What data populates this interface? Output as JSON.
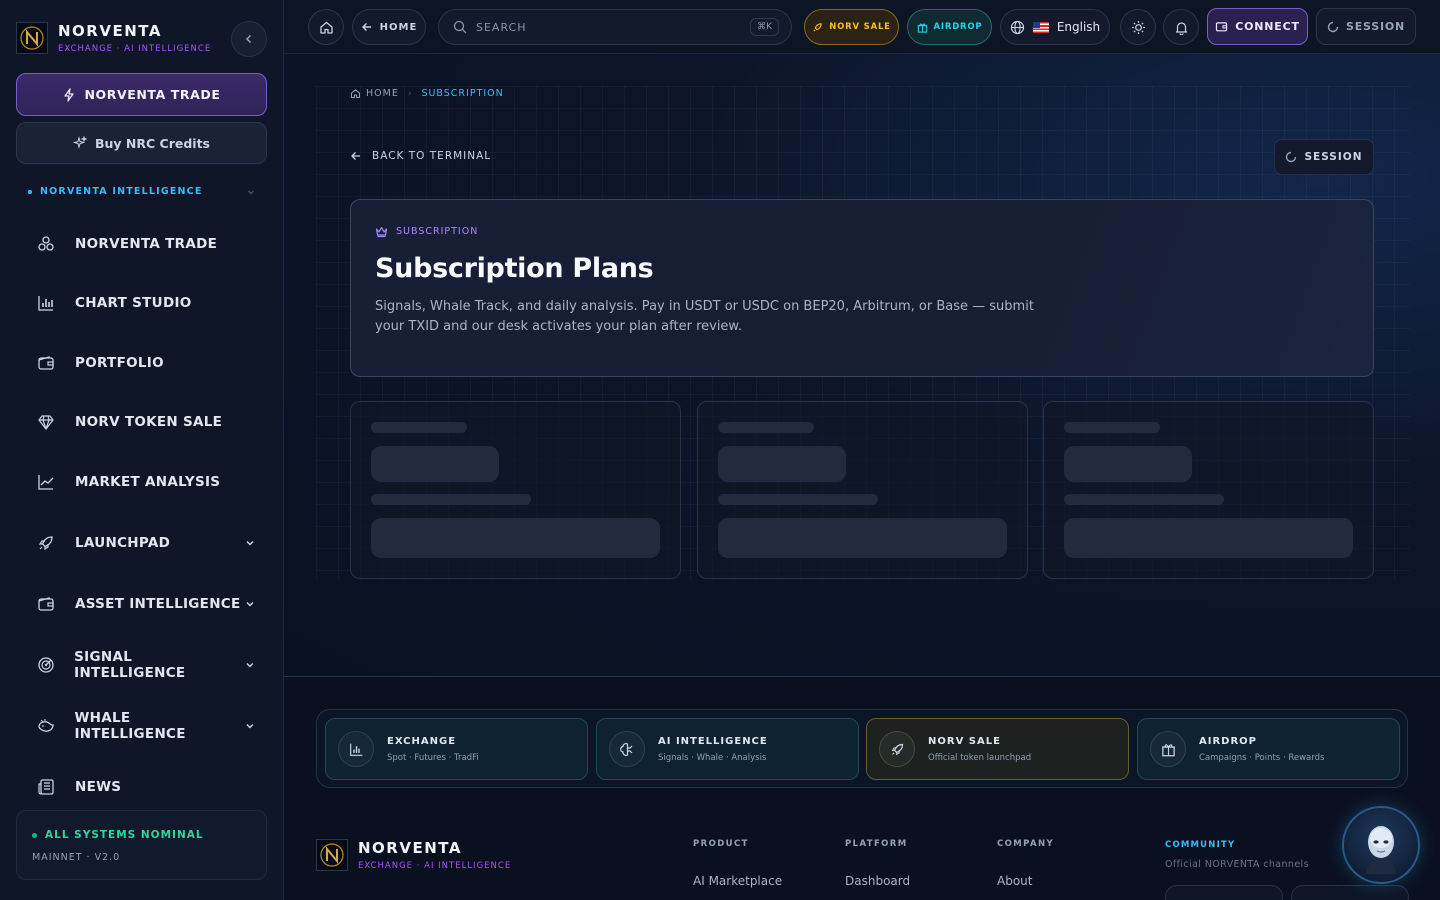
{
  "brand": {
    "name": "NORVENTA",
    "tagline": "EXCHANGE · AI INTELLIGENCE"
  },
  "sidebar": {
    "primary_button": "NORVENTA TRADE",
    "secondary_button": "Buy NRC Credits",
    "section_title": "NORVENTA INTELLIGENCE",
    "items": [
      {
        "label": "NORVENTA TRADE",
        "icon": "nodes-icon"
      },
      {
        "label": "CHART STUDIO",
        "icon": "chart-bars-icon"
      },
      {
        "label": "PORTFOLIO",
        "icon": "wallet-icon"
      },
      {
        "label": "NORV TOKEN SALE",
        "icon": "diamond-icon"
      },
      {
        "label": "MARKET ANALYSIS",
        "icon": "line-chart-icon"
      },
      {
        "label": "LAUNCHPAD",
        "icon": "rocket-icon"
      },
      {
        "label": "ASSET INTELLIGENCE",
        "icon": "wallet-icon"
      },
      {
        "label": "SIGNAL INTELLIGENCE",
        "icon": "radar-icon"
      },
      {
        "label": "WHALE INTELLIGENCE",
        "icon": "whale-icon"
      },
      {
        "label": "NEWS",
        "icon": "newspaper-icon"
      }
    ],
    "status": {
      "label": "ALL SYSTEMS NOMINAL",
      "sub": "MAINNET · V2.0"
    }
  },
  "topbar": {
    "back_label": "HOME",
    "search_placeholder": "SEARCH",
    "search_shortcut": "⌘K",
    "sale_label": "NORV SALE",
    "airdrop_label": "AIRDROP",
    "language": "English",
    "connect_label": "CONNECT",
    "session_label": "SESSION"
  },
  "breadcrumb": {
    "home": "HOME",
    "current": "SUBSCRIPTION"
  },
  "page": {
    "back_link": "BACK TO TERMINAL",
    "session_label": "SESSION",
    "tag": "SUBSCRIPTION",
    "title": "Subscription Plans",
    "description": "Signals, Whale Track, and daily analysis. Pay in USDT or USDC on BEP20, Arbitrum, or Base — submit your TXID and our desk activates your plan after review."
  },
  "footer": {
    "quick": [
      {
        "title": "EXCHANGE",
        "sub": "Spot · Futures · TradFi",
        "icon": "chart-bars-icon"
      },
      {
        "title": "AI INTELLIGENCE",
        "sub": "Signals · Whale · Analysis",
        "icon": "brain-icon"
      },
      {
        "title": "NORV SALE",
        "sub": "Official token launchpad",
        "icon": "rocket-icon"
      },
      {
        "title": "AIRDROP",
        "sub": "Campaigns · Points · Rewards",
        "icon": "gift-icon"
      }
    ],
    "columns": [
      {
        "title": "PRODUCT",
        "first_link": "AI Marketplace"
      },
      {
        "title": "PLATFORM",
        "first_link": "Dashboard"
      },
      {
        "title": "COMPANY",
        "first_link": "About"
      }
    ],
    "community": {
      "title": "COMMUNITY",
      "sub": "Official NORVENTA channels"
    }
  },
  "colors": {
    "accent_purple": "#7c5bd1",
    "accent_cyan": "#38bdf8",
    "gold": "#fbbf24",
    "status_green": "#34d399"
  }
}
